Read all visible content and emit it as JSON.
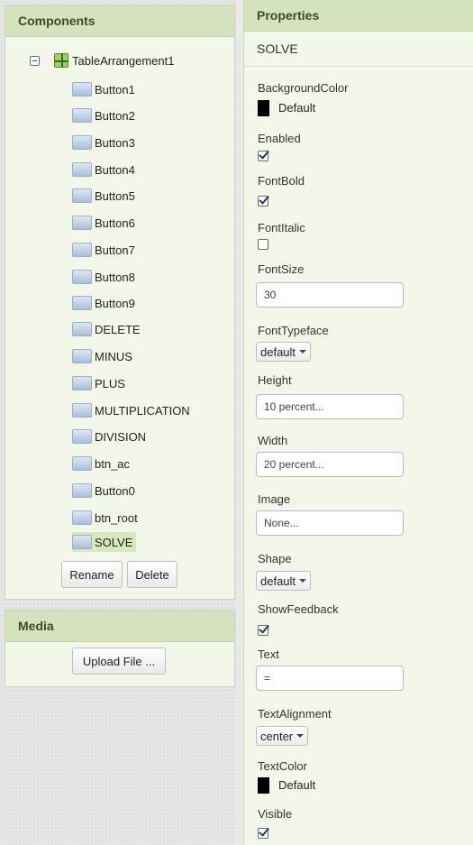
{
  "components_panel": {
    "title": "Components",
    "root": "TableArrangement1",
    "items": [
      "Button1",
      "Button2",
      "Button3",
      "Button4",
      "Button5",
      "Button6",
      "Button7",
      "Button8",
      "Button9",
      "DELETE",
      "MINUS",
      "PLUS",
      "MULTIPLICATION",
      "DIVISION",
      "btn_ac",
      "Button0",
      "btn_root",
      "SOLVE"
    ],
    "selected": "SOLVE",
    "rename_label": "Rename",
    "delete_label": "Delete"
  },
  "media_panel": {
    "title": "Media",
    "upload_label": "Upload File ..."
  },
  "properties_panel": {
    "title": "Properties",
    "component_name": "SOLVE",
    "background_color": {
      "label": "BackgroundColor",
      "value": "Default",
      "color": "#000000"
    },
    "enabled": {
      "label": "Enabled",
      "checked": true
    },
    "font_bold": {
      "label": "FontBold",
      "checked": true
    },
    "font_italic": {
      "label": "FontItalic",
      "checked": false
    },
    "font_size": {
      "label": "FontSize",
      "value": "30"
    },
    "font_typeface": {
      "label": "FontTypeface",
      "value": "default"
    },
    "height": {
      "label": "Height",
      "value": "10 percent..."
    },
    "width": {
      "label": "Width",
      "value": "20 percent..."
    },
    "image": {
      "label": "Image",
      "value": "None..."
    },
    "shape": {
      "label": "Shape",
      "value": "default"
    },
    "show_feedback": {
      "label": "ShowFeedback",
      "checked": true
    },
    "text": {
      "label": "Text",
      "value": "="
    },
    "text_alignment": {
      "label": "TextAlignment",
      "value": "center"
    },
    "text_color": {
      "label": "TextColor",
      "value": "Default",
      "color": "#000000"
    },
    "visible": {
      "label": "Visible",
      "checked": true
    }
  }
}
